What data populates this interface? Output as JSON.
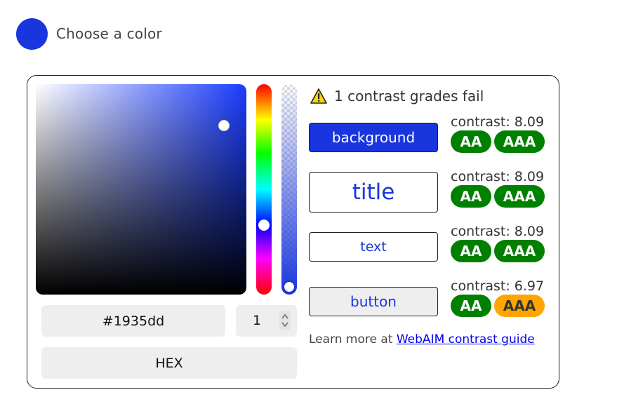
{
  "header": {
    "selected_color": "#1935dd",
    "title": "Choose a color"
  },
  "picker": {
    "hex_value": "#1935dd",
    "alpha_value": "1",
    "format_label": "HEX",
    "saturation": 0.86,
    "brightness": 0.84,
    "hue_position": 0.635,
    "alpha_level": 1
  },
  "contrast": {
    "warning_icon": "warning-triangle-icon",
    "warning_text": "1 contrast grades fail",
    "items": [
      {
        "preview_label": "background",
        "contrast_text": "contrast: 8.09",
        "aa": "AA",
        "aaa": "AAA",
        "aa_pass": true,
        "aaa_pass": true
      },
      {
        "preview_label": "title",
        "contrast_text": "contrast: 8.09",
        "aa": "AA",
        "aaa": "AAA",
        "aa_pass": true,
        "aaa_pass": true
      },
      {
        "preview_label": "text",
        "contrast_text": "contrast: 8.09",
        "aa": "AA",
        "aaa": "AAA",
        "aa_pass": true,
        "aaa_pass": true
      },
      {
        "preview_label": "button",
        "contrast_text": "contrast: 6.97",
        "aa": "AA",
        "aaa": "AAA",
        "aa_pass": true,
        "aaa_pass": false
      }
    ],
    "learn_prefix": "Learn more at",
    "learn_link": "WebAIM contrast guide"
  },
  "colors": {
    "accent": "#1935dd",
    "pass": "#008000",
    "fail": "#ffa500",
    "field_bg": "#eeeeee"
  }
}
